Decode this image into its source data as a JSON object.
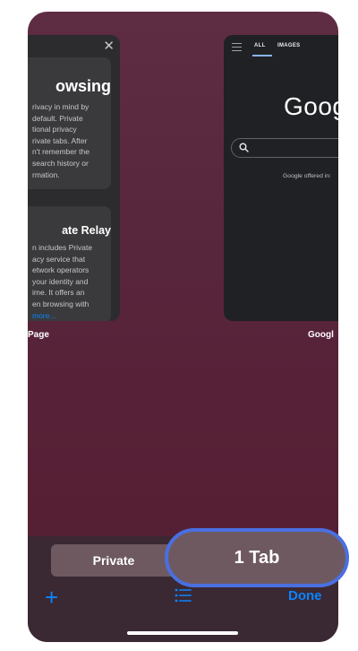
{
  "left_tab": {
    "panel1_title": "owsing",
    "panel1_lines": [
      "rivacy in mind by",
      "default. Private",
      "tional privacy",
      "rivate tabs. After",
      "n't remember the",
      "search history or",
      "rmation."
    ],
    "panel2_title": "ate Relay",
    "panel2_lines": [
      "n includes Private",
      "acy service that",
      "etwork operators",
      "your identity and",
      "ime. It offers an",
      "en browsing with"
    ],
    "panel2_more": "more...",
    "label": "Page"
  },
  "right_tab": {
    "tab_all": "ALL",
    "tab_images": "IMAGES",
    "logo": "Goog",
    "offered_in": "Google offered in:",
    "label": "Googl"
  },
  "bottom_bar": {
    "private_label": "Private",
    "tab_count_label": "1 Tab",
    "done_label": "Done",
    "accent_color": "#0a84ff"
  }
}
